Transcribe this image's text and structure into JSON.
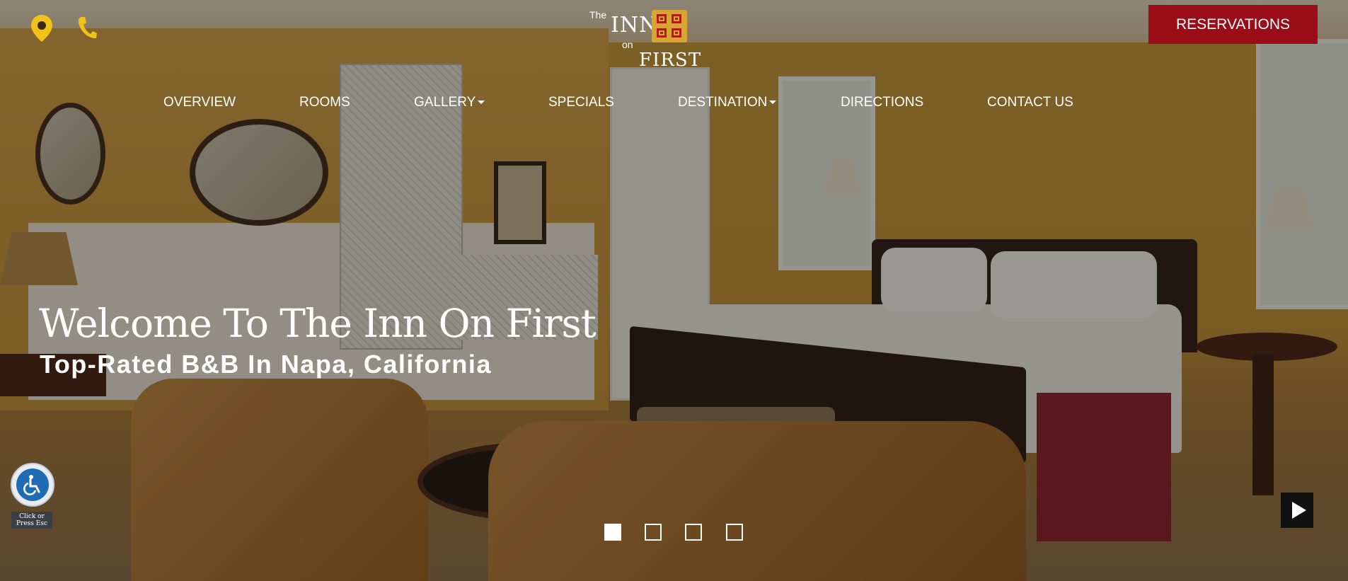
{
  "header": {
    "logo": {
      "the": "The",
      "inn": "INN",
      "on": "on",
      "first": "FIRST",
      "brand_red": "#b31b1b",
      "brand_gold": "#d9a531"
    },
    "icons": [
      "map-pin-icon",
      "phone-icon"
    ],
    "icon_color": "#f2c218",
    "reservations_label": "RESERVATIONS",
    "reservations_color": "#9a0d18"
  },
  "nav": {
    "items": [
      {
        "label": "OVERVIEW",
        "dropdown": false
      },
      {
        "label": "ROOMS",
        "dropdown": false
      },
      {
        "label": "GALLERY",
        "dropdown": true
      },
      {
        "label": "SPECIALS",
        "dropdown": false
      },
      {
        "label": "DESTINATION",
        "dropdown": true
      },
      {
        "label": "DIRECTIONS",
        "dropdown": false
      },
      {
        "label": "CONTACT US",
        "dropdown": false
      }
    ]
  },
  "hero": {
    "title": "Welcome To The Inn On First",
    "subtitle": "Top-Rated B&B In Napa, California"
  },
  "accessibility": {
    "icon": "wheelchair-icon",
    "hint": "Click or Press Esc"
  },
  "slider": {
    "slide_count": 4,
    "active_slide": 1,
    "control_icon": "play-icon"
  }
}
